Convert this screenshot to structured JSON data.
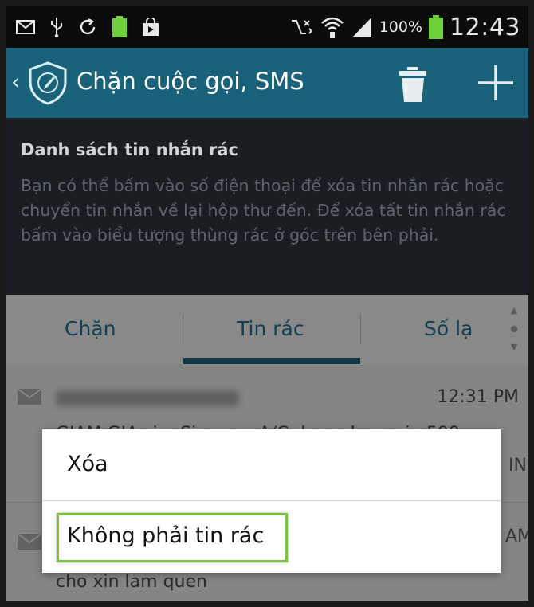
{
  "status_bar": {
    "icons": [
      "mail-icon",
      "usb-icon",
      "sync-icon",
      "battery-full-icon",
      "shopping-bag-icon"
    ],
    "signal_icons": [
      "nfc-icon",
      "wifi-icon",
      "cell-signal-icon"
    ],
    "battery_percent": "100%",
    "time": "12:43"
  },
  "app_bar": {
    "title": "Chặn cuộc gọi, SMS",
    "actions": [
      "trash-icon",
      "plus-icon"
    ]
  },
  "info": {
    "title": "Danh sách tin nhắn rác",
    "body": "Bạn có thể bấm vào số điện thoại để xóa tin nhắn rác hoặc chuyển tin nhắn về lại hộp thư đến. Để xóa tất tin nhắn rác bấm vào biểu tượng thùng rác ở góc trên bên phải."
  },
  "tabs": {
    "items": [
      {
        "label": "Chặn"
      },
      {
        "label": "Tin rác"
      },
      {
        "label": "Số lạ"
      }
    ],
    "selected_index": 1
  },
  "messages": [
    {
      "time": "12:31 PM",
      "preview": "GIAM GIA sim Sieng ss A/C dang dung gia 599"
    },
    {
      "time": "",
      "preview": "cho xin lam quen"
    }
  ],
  "dialog": {
    "items": [
      {
        "label": "Xóa"
      },
      {
        "label": "Không phải tin rác"
      }
    ],
    "partial_right_text": [
      "IN",
      "AM"
    ]
  },
  "colors": {
    "app_bar": "#1a6279",
    "info_panel": "#1a1d21",
    "tab_text": "#1d6f8e",
    "highlight": "#79c143"
  }
}
